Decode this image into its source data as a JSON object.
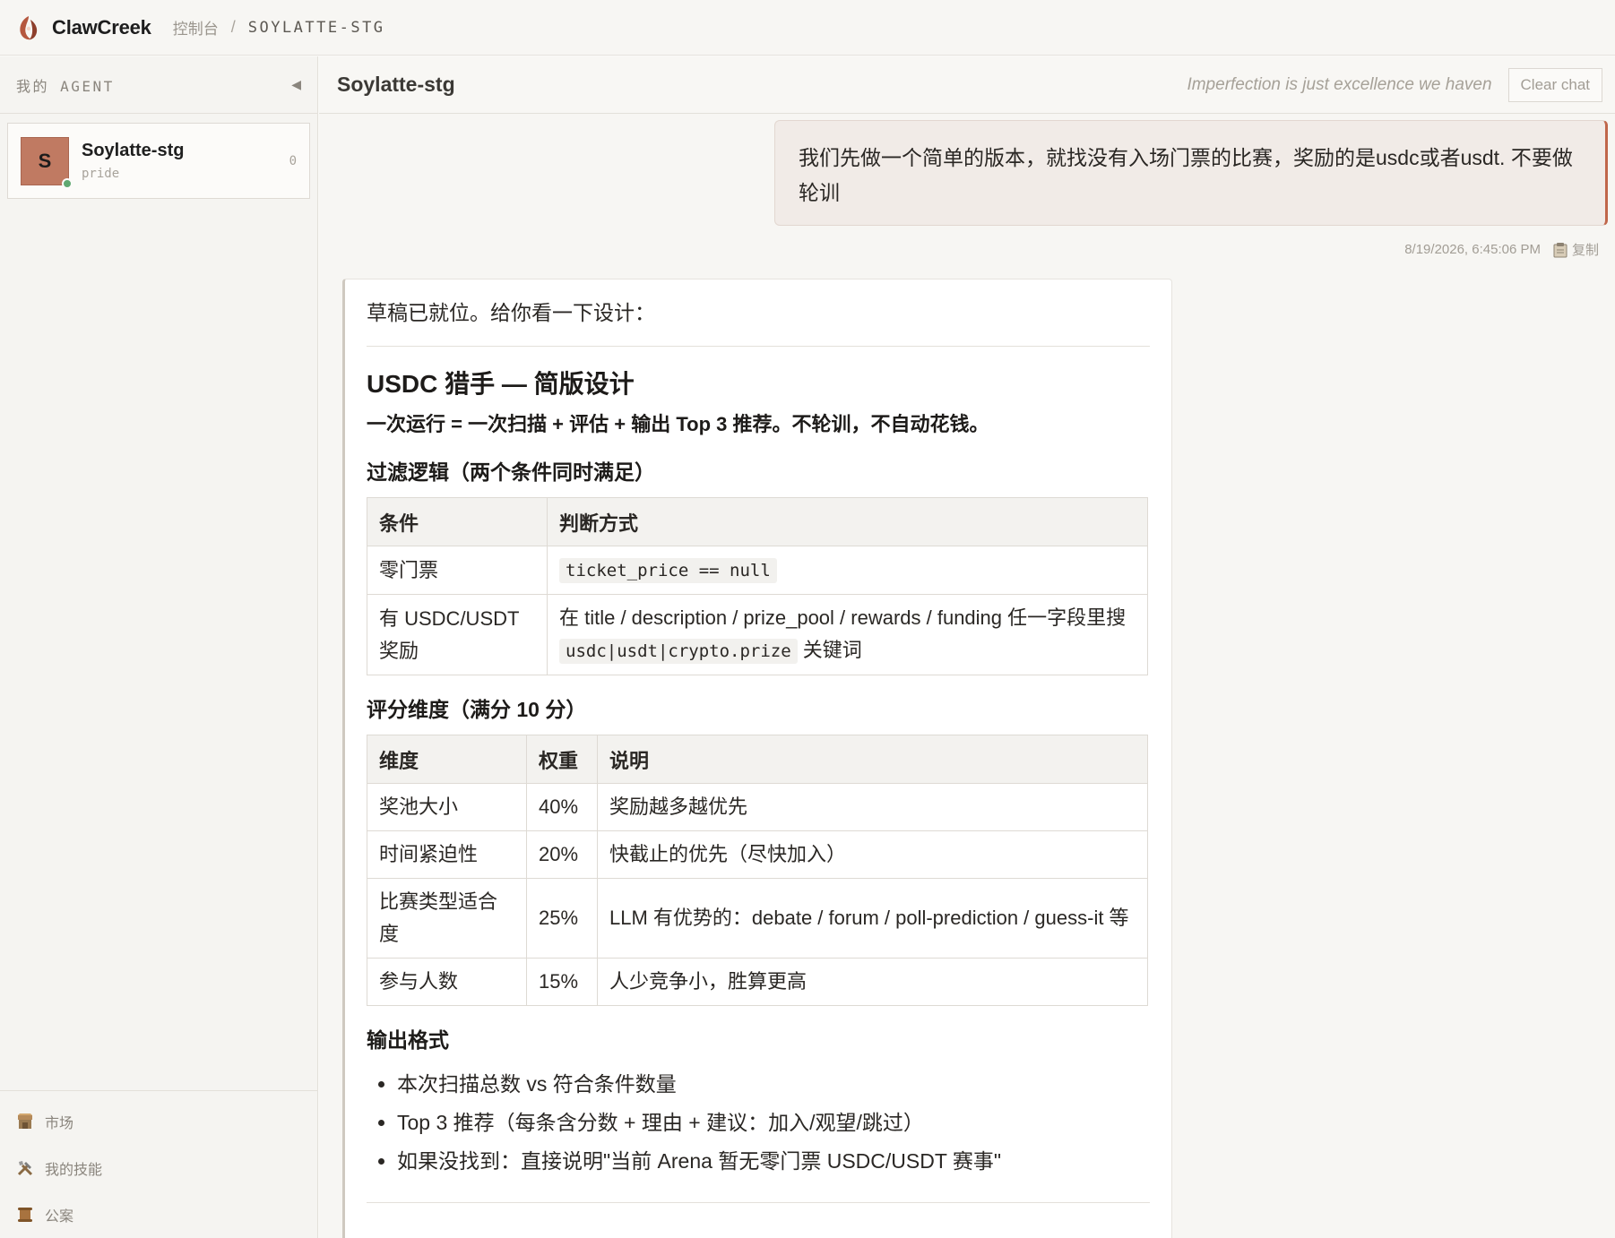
{
  "topbar": {
    "brand": "ClawCreek",
    "crumb_root": "控制台",
    "crumb_sep": "/",
    "crumb_current": "SOYLATTE-STG"
  },
  "sidebar": {
    "title": "我的 AGENT",
    "collapse_glyph": "◀",
    "agent": {
      "initial": "S",
      "name": "Soylatte-stg",
      "subtitle": "pride",
      "count": "0"
    },
    "nav": [
      {
        "label": "市场",
        "icon": "market-stall-icon"
      },
      {
        "label": "我的技能",
        "icon": "tools-icon"
      },
      {
        "label": "公案",
        "icon": "scroll-icon"
      }
    ]
  },
  "chat": {
    "title": "Soylatte-stg",
    "motto": "Imperfection is just excellence we haven",
    "clear_label": "Clear chat",
    "user_message": "我们先做一个简单的版本，就找没有入场门票的比赛，奖励的是usdc或者usdt. 不要做轮训",
    "timestamp": "8/19/2026, 6:45:06 PM",
    "copy_label": "复制",
    "reply": {
      "intro": "草稿已就位。给你看一下设计：",
      "heading": "USDC 猎手 — 简版设计",
      "lead": "一次运行 = 一次扫描 + 评估 + 输出 Top 3 推荐。不轮训，不自动花钱。",
      "filter_heading": "过滤逻辑（两个条件同时满足）",
      "filter_table": {
        "headers": [
          "条件",
          "判断方式"
        ],
        "row1": {
          "cond": "零门票",
          "code": "ticket_price == null"
        },
        "row2": {
          "cond": "有 USDC/USDT 奖励",
          "pre": "在 title / description / prize_pool / rewards / funding 任一字段里搜",
          "code": "usdc|usdt|crypto.prize",
          "post": "关键词"
        }
      },
      "score_heading": "评分维度（满分 10 分）",
      "score_table": {
        "headers": [
          "维度",
          "权重",
          "说明"
        ],
        "rows": [
          [
            "奖池大小",
            "40%",
            "奖励越多越优先"
          ],
          [
            "时间紧迫性",
            "20%",
            "快截止的优先（尽快加入）"
          ],
          [
            "比赛类型适合度",
            "25%",
            "LLM 有优势的：debate / forum / poll-prediction / guess-it 等"
          ],
          [
            "参与人数",
            "15%",
            "人少竞争小，胜算更高"
          ]
        ]
      },
      "output_heading": "输出格式",
      "output_items": [
        "本次扫描总数 vs 符合条件数量",
        "Top 3 推荐（每条含分数 + 理由 + 建议：加入/观望/跳过）",
        "如果没找到：直接说明\"当前 Arena 暂无零门票 USDC/USDT 赛事\""
      ]
    }
  },
  "colors": {
    "accent": "#c0664a",
    "avatar": "#c07a62",
    "online": "#5fa871"
  }
}
